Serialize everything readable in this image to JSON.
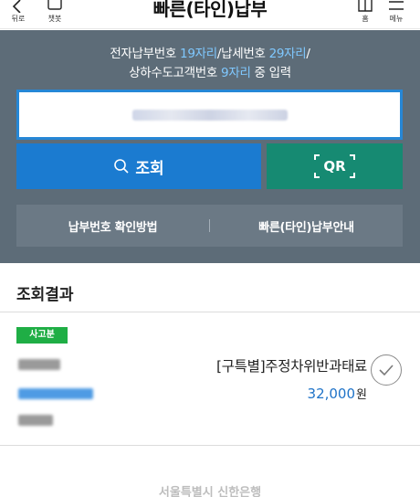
{
  "topbar": {
    "back_label": "뒤로",
    "chatbot_label": "챗봇",
    "title": "빠른(타인)납부",
    "home_label": "홈",
    "menu_label": "메뉴"
  },
  "guide": {
    "line1_a": "전자납부번호 ",
    "line1_b": "19자리",
    "line1_c": "/납세번호 ",
    "line1_d": "29자리",
    "line1_e": "/",
    "line2_a": "상하수도고객번호 ",
    "line2_b": "9자리",
    "line2_c": " 중 입력"
  },
  "search": {
    "button_label": "조회",
    "qr_label": "QR"
  },
  "links": {
    "how_to_check": "납부번호 확인방법",
    "quick_guide": "빠른(타인)납부안내"
  },
  "results": {
    "title": "조회결과",
    "item": {
      "badge": "사고분",
      "name": "[구특별]주정차위반과태료",
      "amount": "32,000",
      "unit": "원"
    }
  },
  "footer": {
    "text": "서울특별시 신한은행"
  },
  "colors": {
    "panel": "#5d6c78",
    "search_button": "#1b7bd0",
    "qr_button": "#168a72",
    "accent_text": "#7fc8ff",
    "amount": "#1f73c8",
    "badge": "#1fae45"
  }
}
